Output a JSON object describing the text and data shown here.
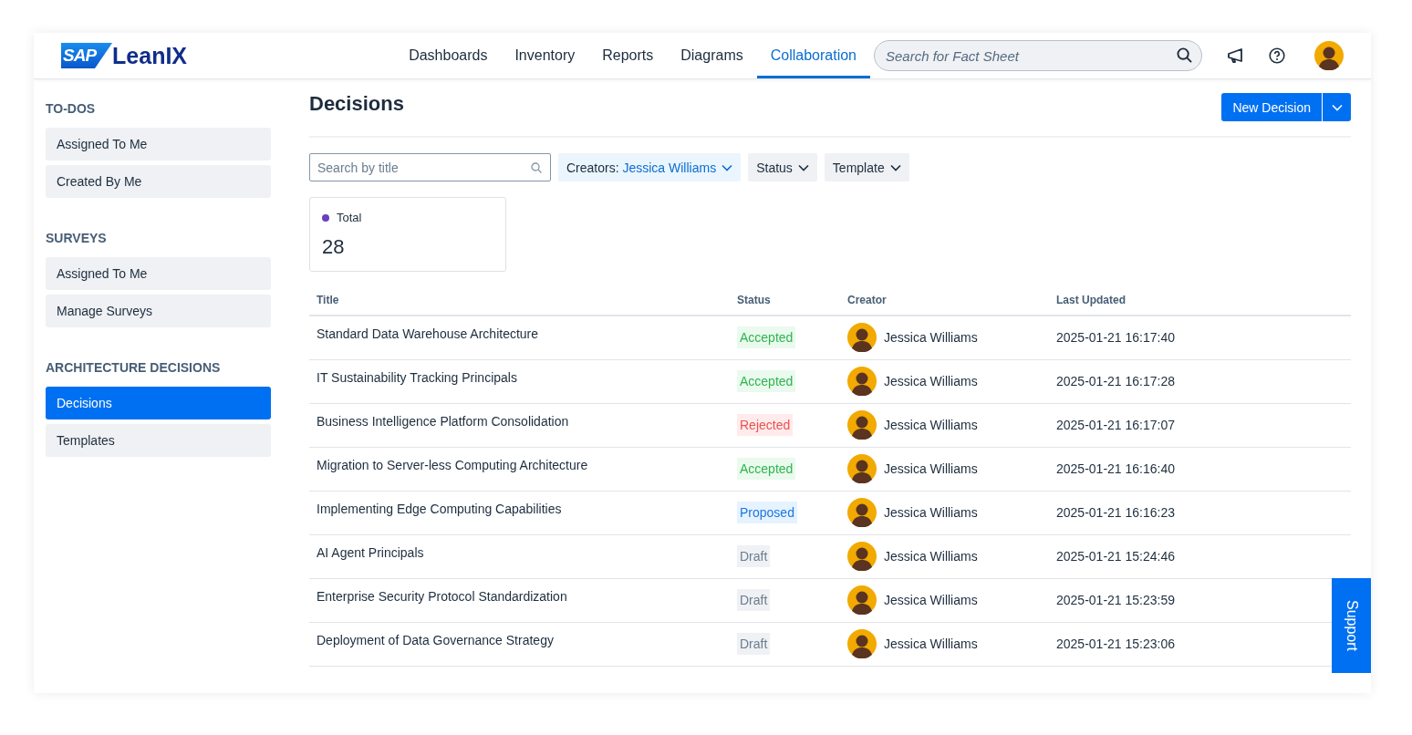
{
  "header": {
    "logo": {
      "badge": "SAP",
      "name": "LeanIX"
    },
    "nav": [
      {
        "label": "Dashboards",
        "selected": false
      },
      {
        "label": "Inventory",
        "selected": false
      },
      {
        "label": "Reports",
        "selected": false
      },
      {
        "label": "Diagrams",
        "selected": false
      },
      {
        "label": "Collaboration",
        "selected": true
      }
    ],
    "search": {
      "placeholder": "Search for Fact Sheet"
    }
  },
  "sidebar": {
    "sections": [
      {
        "title": "TO-DOS",
        "items": [
          {
            "label": "Assigned To Me",
            "selected": false
          },
          {
            "label": "Created By Me",
            "selected": false
          }
        ]
      },
      {
        "title": "SURVEYS",
        "items": [
          {
            "label": "Assigned To Me",
            "selected": false
          },
          {
            "label": "Manage Surveys",
            "selected": false
          }
        ]
      },
      {
        "title": "ARCHITECTURE DECISIONS",
        "items": [
          {
            "label": "Decisions",
            "selected": true
          },
          {
            "label": "Templates",
            "selected": false
          }
        ]
      }
    ]
  },
  "main": {
    "title": "Decisions",
    "new_button": "New Decision",
    "filters": {
      "search": {
        "placeholder": "Search by title"
      },
      "creators": {
        "label": "Creators:",
        "value": "Jessica Williams"
      },
      "dropdowns": [
        "Status",
        "Template"
      ]
    },
    "summary": {
      "label": "Total",
      "value": "28",
      "color": "#6a3fc1"
    },
    "table": {
      "columns": [
        "Title",
        "Status",
        "Creator",
        "Last Updated"
      ],
      "rows": [
        {
          "title": "Standard Data Warehouse Architecture",
          "status": {
            "label": "Accepted",
            "kind": "accepted"
          },
          "creator": "Jessica Williams",
          "updated": "2025-01-21 16:17:40"
        },
        {
          "title": "IT Sustainability Tracking Principals",
          "status": {
            "label": "Accepted",
            "kind": "accepted"
          },
          "creator": "Jessica Williams",
          "updated": "2025-01-21 16:17:28"
        },
        {
          "title": "Business Intelligence Platform Consolidation",
          "status": {
            "label": "Rejected",
            "kind": "rejected"
          },
          "creator": "Jessica Williams",
          "updated": "2025-01-21 16:17:07"
        },
        {
          "title": "Migration to Server-less Computing Architecture",
          "status": {
            "label": "Accepted",
            "kind": "accepted"
          },
          "creator": "Jessica Williams",
          "updated": "2025-01-21 16:16:40"
        },
        {
          "title": "Implementing Edge Computing Capabilities",
          "status": {
            "label": "Proposed",
            "kind": "proposed"
          },
          "creator": "Jessica Williams",
          "updated": "2025-01-21 16:16:23"
        },
        {
          "title": "AI Agent Principals",
          "status": {
            "label": "Draft",
            "kind": "draft"
          },
          "creator": "Jessica Williams",
          "updated": "2025-01-21 15:24:46"
        },
        {
          "title": "Enterprise Security Protocol Standardization",
          "status": {
            "label": "Draft",
            "kind": "draft"
          },
          "creator": "Jessica Williams",
          "updated": "2025-01-21 15:23:59"
        },
        {
          "title": "Deployment of Data Governance Strategy",
          "status": {
            "label": "Draft",
            "kind": "draft"
          },
          "creator": "Jessica Williams",
          "updated": "2025-01-21 15:23:06"
        }
      ]
    }
  },
  "support_tab": "Support"
}
